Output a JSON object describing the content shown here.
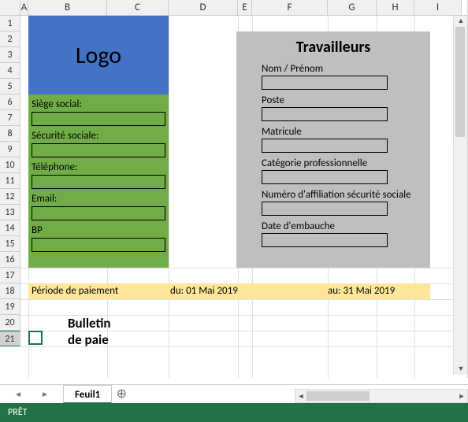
{
  "columns": [
    "A",
    "B",
    "C",
    "D",
    "E",
    "F",
    "G",
    "H",
    "I"
  ],
  "rows": [
    "1",
    "2",
    "3",
    "4",
    "5",
    "6",
    "7",
    "8",
    "9",
    "10",
    "11",
    "12",
    "13",
    "14",
    "15",
    "16",
    "17",
    "18",
    "19",
    "20",
    "21"
  ],
  "active_row": 21,
  "logo": "Logo",
  "company": {
    "siege": "Siège social:",
    "secu": "Sécurité sociale:",
    "tel": "Téléphone:",
    "email": "Email:",
    "bp": "BP"
  },
  "workers": {
    "title": "Travailleurs",
    "nom": "Nom / Prénom",
    "poste": "Poste",
    "matricule": "Matricule",
    "categorie": "Catégorie professionnelle",
    "numero": "Numéro d'affiliation sécurité sociale",
    "embauche": "Date d'embauche"
  },
  "period": {
    "label": "Période de paiement",
    "from": "du: 01 Mai 2019",
    "to": "au: 31 Mai 2019"
  },
  "bulletin": "Bulletin de paie",
  "sheet_tab": "Feuil1",
  "add_tab": "⊕",
  "status": "PRÊT"
}
